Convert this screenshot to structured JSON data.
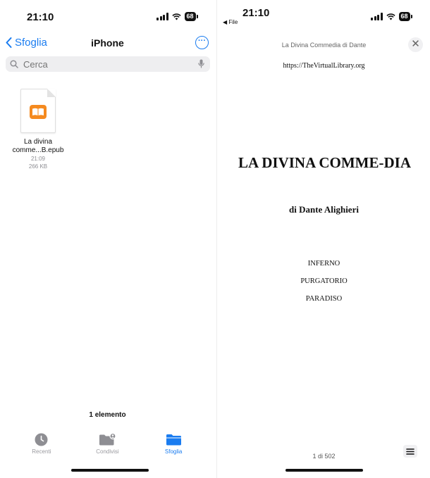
{
  "left": {
    "status": {
      "time": "21:10",
      "battery": "68"
    },
    "nav": {
      "back_label": "Sfoglia",
      "title": "iPhone"
    },
    "search": {
      "placeholder": "Cerca"
    },
    "file": {
      "name_line1": "La divina",
      "name_line2": "comme...B.epub",
      "time": "21:09",
      "size": "266 KB"
    },
    "item_count": "1 elemento",
    "tabs": [
      {
        "label": "Recenti",
        "icon": "clock-icon",
        "active": false
      },
      {
        "label": "Condivisi",
        "icon": "shared-folder-icon",
        "active": false
      },
      {
        "label": "Sfoglia",
        "icon": "folder-icon",
        "active": true
      }
    ]
  },
  "right": {
    "status": {
      "time": "21:10",
      "battery": "68",
      "back_app": "File"
    },
    "header_title": "La Divina Commedia di Dante",
    "url": "https://TheVirtualLibrary.org",
    "book_title": "LA DIVINA COMME-DIA",
    "author": "di Dante Alighieri",
    "parts": [
      "INFERNO",
      "PURGATORIO",
      "PARADISO"
    ],
    "page_info": "1 di 502"
  },
  "colors": {
    "accent": "#1a7cf0",
    "book_icon": "#f58a1f",
    "inactive": "#9a9a9f"
  }
}
